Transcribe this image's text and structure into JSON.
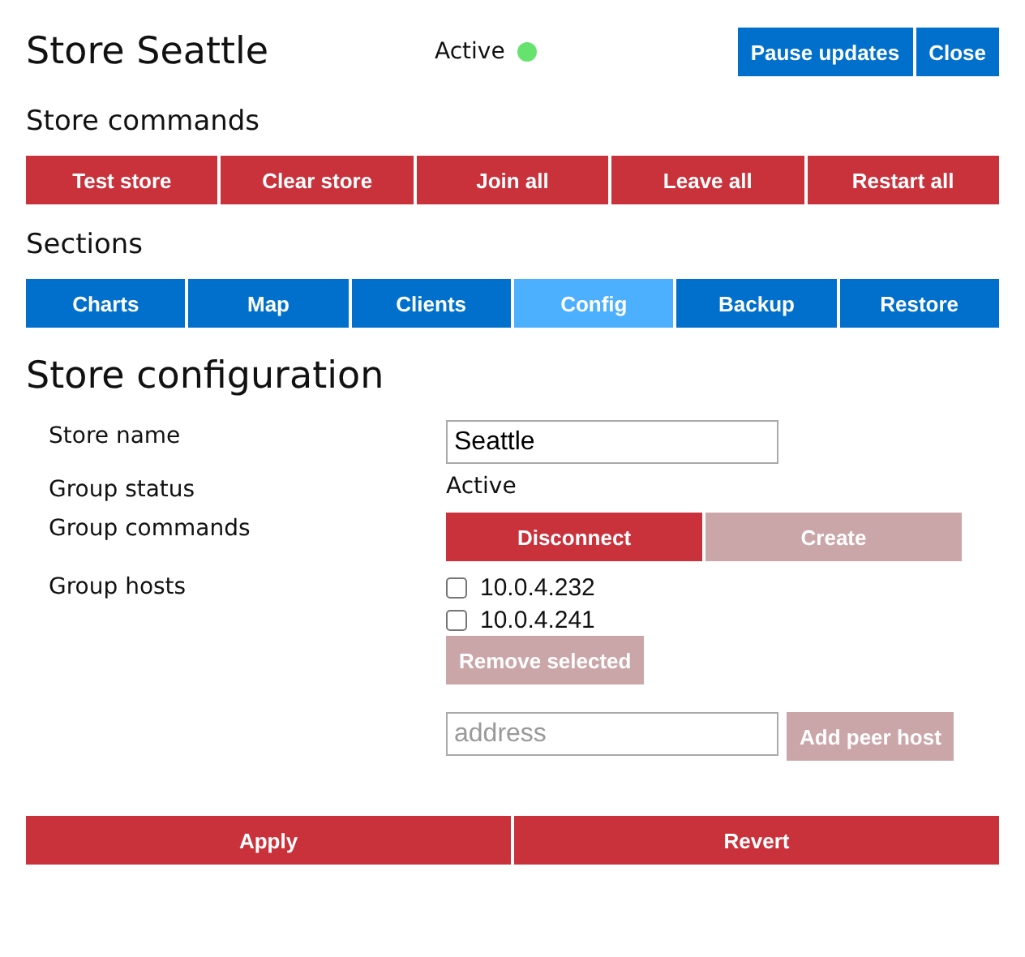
{
  "header": {
    "title": "Store Seattle",
    "status": "Active",
    "online": true,
    "buttons": [
      {
        "label": "Pause updates"
      },
      {
        "label": "Close"
      }
    ]
  },
  "store_commands": {
    "heading": "Store commands",
    "buttons": [
      {
        "label": "Test store"
      },
      {
        "label": "Clear store"
      },
      {
        "label": "Join all"
      },
      {
        "label": "Leave all"
      },
      {
        "label": "Restart all"
      }
    ]
  },
  "sections": {
    "heading": "Sections",
    "tabs": [
      {
        "label": "Charts",
        "selected": false
      },
      {
        "label": "Map",
        "selected": false
      },
      {
        "label": "Clients",
        "selected": false
      },
      {
        "label": "Config",
        "selected": true
      },
      {
        "label": "Backup",
        "selected": false
      },
      {
        "label": "Restore",
        "selected": false
      }
    ]
  },
  "config": {
    "heading": "Store configuration",
    "store_name": {
      "label": "Store name",
      "value": "Seattle"
    },
    "group_status": {
      "label": "Group status",
      "value": "Active"
    },
    "group_commands": {
      "label": "Group commands",
      "buttons": [
        {
          "label": "Disconnect",
          "disabled": false
        },
        {
          "label": "Create",
          "disabled": true
        }
      ]
    },
    "group_hosts": {
      "label": "Group hosts",
      "hosts": [
        {
          "address": "10.0.4.232",
          "checked": false
        },
        {
          "address": "10.0.4.241",
          "checked": false
        }
      ],
      "remove": {
        "label": "Remove selected",
        "disabled": true
      },
      "add_field": {
        "placeholder": "address"
      },
      "add": {
        "label": "Add peer host",
        "disabled": true
      }
    }
  },
  "footer": {
    "buttons": [
      {
        "label": "Apply"
      },
      {
        "label": "Revert"
      }
    ]
  }
}
